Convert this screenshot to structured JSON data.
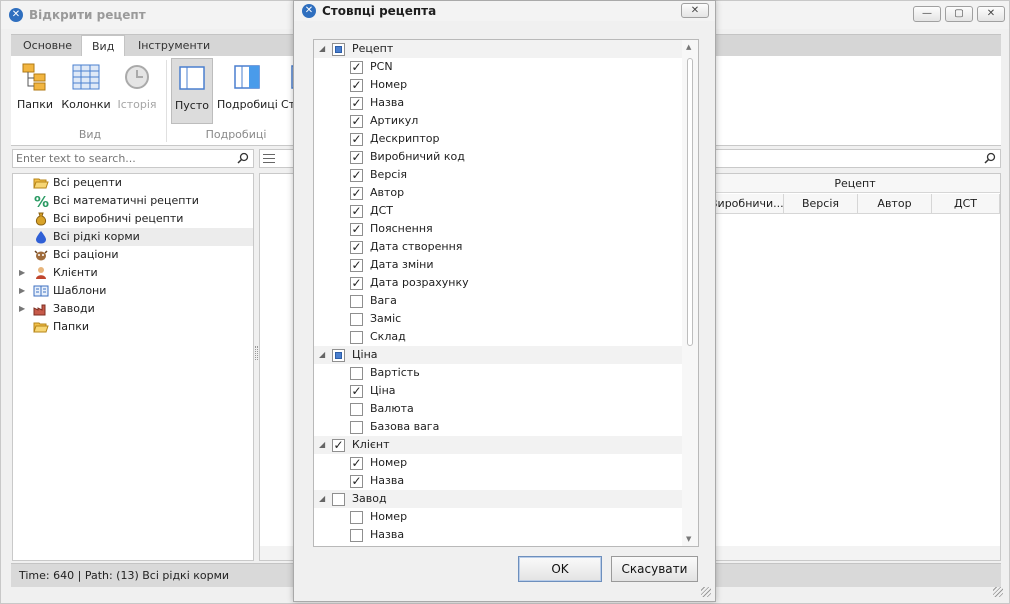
{
  "window": {
    "title": "Відкрити рецепт",
    "controls": [
      "—",
      "▢",
      "✕"
    ]
  },
  "ribbon": {
    "tabs": [
      "Основне",
      "Вид",
      "Інструменти"
    ],
    "buttons": [
      "Папки",
      "Колонки",
      "Історія",
      "Пусто",
      "Подробиці",
      "Ст"
    ],
    "groups": [
      "Вид",
      "Подробиці"
    ]
  },
  "search": {
    "placeholder": "Enter text to search..."
  },
  "tree": {
    "items": [
      {
        "label": "Всі рецепти",
        "icon": "folder-open-icon"
      },
      {
        "label": "Всі математичні рецепти",
        "icon": "percent-icon"
      },
      {
        "label": "Всі виробничі рецепти",
        "icon": "money-bag-icon"
      },
      {
        "label": "Всі рідкі корми",
        "icon": "drop-icon"
      },
      {
        "label": "Всі раціони",
        "icon": "cow-icon"
      },
      {
        "label": "Клієнти",
        "icon": "person-icon"
      },
      {
        "label": "Шаблони",
        "icon": "book-icon"
      },
      {
        "label": "Заводи",
        "icon": "factory-icon"
      },
      {
        "label": "Папки",
        "icon": "folder-open-icon"
      }
    ]
  },
  "grid": {
    "band": "Рецепт",
    "columns": [
      "Виробничи...",
      "Версія",
      "Автор",
      "ДСТ"
    ]
  },
  "status": {
    "text": "Time: 640 | Path: (13) Всі рідкі корми"
  },
  "dialog": {
    "title": "Стовпці рецепта",
    "close": "✕",
    "rows": [
      {
        "label": "Рецепт",
        "group": true,
        "state": "mixed"
      },
      {
        "label": "PCN",
        "state": "checked"
      },
      {
        "label": "Номер",
        "state": "checked"
      },
      {
        "label": "Назва",
        "state": "checked"
      },
      {
        "label": "Артикул",
        "state": "checked"
      },
      {
        "label": "Дескриптор",
        "state": "checked"
      },
      {
        "label": "Виробничий код",
        "state": "checked"
      },
      {
        "label": "Версія",
        "state": "checked"
      },
      {
        "label": "Автор",
        "state": "checked"
      },
      {
        "label": "ДСТ",
        "state": "checked"
      },
      {
        "label": "Пояснення",
        "state": "checked"
      },
      {
        "label": "Дата створення",
        "state": "checked"
      },
      {
        "label": "Дата зміни",
        "state": "checked"
      },
      {
        "label": "Дата розрахунку",
        "state": "checked"
      },
      {
        "label": "Вага",
        "state": "unchecked"
      },
      {
        "label": "Заміс",
        "state": "unchecked"
      },
      {
        "label": "Склад",
        "state": "unchecked"
      },
      {
        "label": "Ціна",
        "group": true,
        "state": "mixed"
      },
      {
        "label": "Вартість",
        "state": "unchecked"
      },
      {
        "label": "Ціна",
        "state": "checked"
      },
      {
        "label": "Валюта",
        "state": "unchecked"
      },
      {
        "label": "Базова вага",
        "state": "unchecked"
      },
      {
        "label": "Клієнт",
        "group": true,
        "state": "checked"
      },
      {
        "label": "Номер",
        "state": "checked"
      },
      {
        "label": "Назва",
        "state": "checked"
      },
      {
        "label": "Завод",
        "group": true,
        "state": "unchecked"
      },
      {
        "label": "Номер",
        "state": "unchecked"
      },
      {
        "label": "Назва",
        "state": "unchecked"
      }
    ],
    "ok_label": "OK",
    "cancel_label": "Скасувати"
  }
}
